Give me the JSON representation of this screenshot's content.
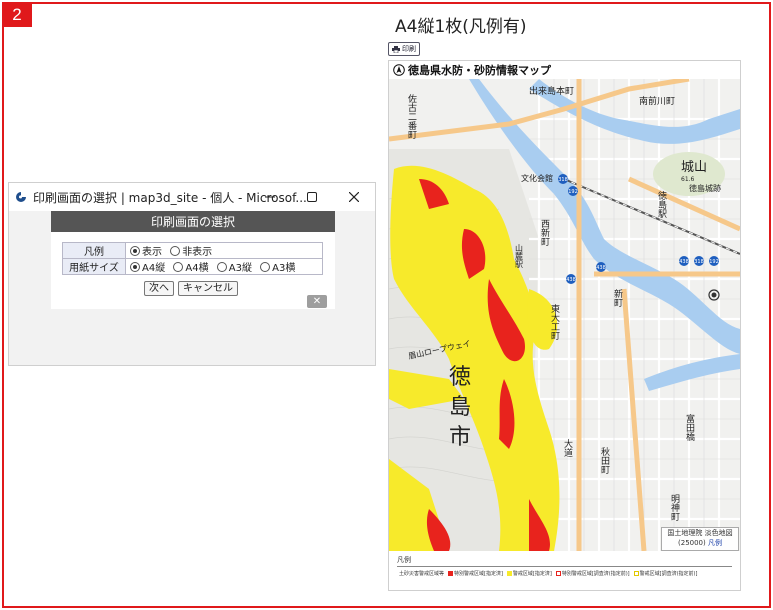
{
  "step_badge": "2",
  "page_heading": "A4縦1枚(凡例有)",
  "dialog": {
    "window_title": "印刷画面の選択 | map3d_site - 個人 - Microsof...",
    "header": "印刷画面の選択",
    "rows": [
      {
        "label": "凡例",
        "options": [
          {
            "text": "表示",
            "checked": true
          },
          {
            "text": "非表示",
            "checked": false
          }
        ]
      },
      {
        "label": "用紙サイズ",
        "options": [
          {
            "text": "A4縦",
            "checked": true
          },
          {
            "text": "A4横",
            "checked": false
          },
          {
            "text": "A3縦",
            "checked": false
          },
          {
            "text": "A3横",
            "checked": false
          }
        ]
      }
    ],
    "next_button": "次へ",
    "cancel_button": "キャンセル",
    "close_button": "✕"
  },
  "preview": {
    "print_button": "印刷",
    "map_title": "徳島県水防・砂防情報マップ",
    "scale_text": "国土地理院 淡色地図",
    "scale_value": "(25000)",
    "legend_link": "凡例",
    "legend_title": "凡例",
    "legend_items": [
      {
        "text": "土砂災害警戒区域等",
        "color": ""
      },
      {
        "text": "特別警戒区域[指定済]",
        "color": "#e8231d"
      },
      {
        "text": "警戒区域[指定済]",
        "color": "#f7ea2b"
      },
      {
        "text": "特別警戒区域[調査済(指定前)]",
        "color": "outline-red"
      },
      {
        "text": "警戒区域[調査済(指定前)]",
        "color": "outline-yellow"
      }
    ],
    "map_labels": {
      "city": [
        "徳",
        "島",
        "市"
      ],
      "castle": "城山",
      "station": "徳島駅",
      "kaikan": "文化会館",
      "shinmachi": "新町",
      "yamazato": "山麓駅",
      "ropeway": "眉山ロープウェイ",
      "akita": "秋田町",
      "myojin": "明神町",
      "tomita": "富田橋",
      "higashi": "東大工町",
      "nishishin": "西新町",
      "jokai": "徳島城跡",
      "deki": "出来島本町",
      "minami": "南前川町",
      "kaido": "大道",
      "tamura": "佐古二番町",
      "elev": "61.6"
    }
  }
}
